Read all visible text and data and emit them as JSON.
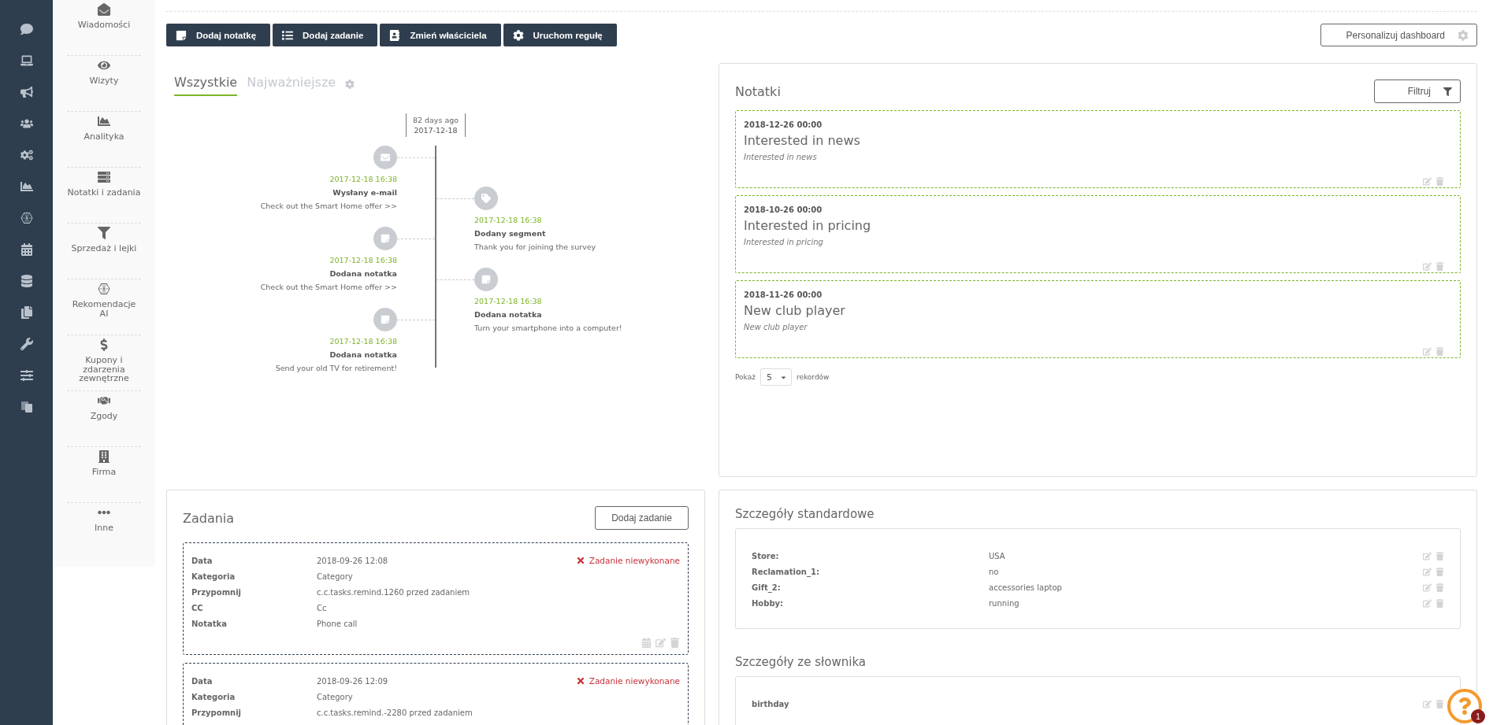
{
  "submenu": [
    {
      "label": "Wiadomości"
    },
    {
      "label": "Wizyty"
    },
    {
      "label": "Analityka"
    },
    {
      "label": "Notatki i zadania"
    },
    {
      "label": "Sprzedaż i lejki"
    },
    {
      "label": "Rekomendacje AI"
    },
    {
      "label": "Kupony i zdarzenia zewnętrzne"
    },
    {
      "label": "Zgody"
    },
    {
      "label": "Firma"
    },
    {
      "label": "Inne"
    }
  ],
  "actions": [
    {
      "label": "Dodaj notatkę"
    },
    {
      "label": "Dodaj zadanie"
    },
    {
      "label": "Zmień właściciela"
    },
    {
      "label": "Uruchom regułę"
    }
  ],
  "personalize_button": "Personalizuj dashboard",
  "timeline": {
    "tabs": [
      {
        "label": "Wszystkie",
        "selected": true
      },
      {
        "label": "Najważniejsze",
        "selected": false
      }
    ],
    "date_marker": {
      "relative": "82 days ago",
      "date": "2017-12-18"
    },
    "events": [
      {
        "kind": "email",
        "time": "2017-12-18 16:38",
        "title": "Wysłany e-mail",
        "text": "Check out the Smart Home offer >>"
      },
      {
        "kind": "segment",
        "time": "2017-12-18 16:38",
        "title": "Dodany segment",
        "text": "Thank you for joining the survey"
      },
      {
        "kind": "note",
        "time": "2017-12-18 16:38",
        "title": "Dodana notatka",
        "text": "Check out the Smart Home offer >>"
      },
      {
        "kind": "note",
        "time": "2017-12-18 16:38",
        "title": "Dodana notatka",
        "text": "Turn your smartphone into a computer!"
      },
      {
        "kind": "note",
        "time": "2017-12-18 16:38",
        "title": "Dodana notatka",
        "text": "Send your old TV for retirement!"
      }
    ]
  },
  "notes": {
    "title": "Notatki",
    "filter_button": "Filtruj",
    "items": [
      {
        "date": "2018-12-26 00:00",
        "title": "Interested in news",
        "text": "Interested in news"
      },
      {
        "date": "2018-10-26 00:00",
        "title": "Interested in pricing",
        "text": "Interested in pricing"
      },
      {
        "date": "2018-11-26 00:00",
        "title": "New club player",
        "text": "New club player"
      }
    ],
    "page_size": {
      "label_before": "Pokaż",
      "value": "5",
      "label_after": "rekordów"
    }
  },
  "tasks": {
    "title": "Zadania",
    "add_button": "Dodaj zadanie",
    "items": [
      {
        "status": "Zadanie niewykonane",
        "fields": [
          {
            "label": "Data",
            "value": "2018-09-26 12:08"
          },
          {
            "label": "Kategoria",
            "value": "Category"
          },
          {
            "label": "Przypomnij",
            "value": "c.c.tasks.remind.1260 przed zadaniem"
          },
          {
            "label": "CC",
            "value": "Cc"
          },
          {
            "label": "Notatka",
            "value": "Phone call"
          }
        ]
      },
      {
        "status": "Zadanie niewykonane",
        "fields": [
          {
            "label": "Data",
            "value": "2018-09-26 12:09"
          },
          {
            "label": "Kategoria",
            "value": "Category"
          },
          {
            "label": "Przypomnij",
            "value": "c.c.tasks.remind.-2280 przed zadaniem"
          }
        ]
      }
    ]
  },
  "standard_details": {
    "title": "Szczegóły standardowe",
    "rows": [
      {
        "label": "Store:",
        "value": "USA"
      },
      {
        "label": "Reclamation_1:",
        "value": "no"
      },
      {
        "label": "Gift_2:",
        "value": "accessories laptop"
      },
      {
        "label": "Hobby:",
        "value": "running"
      }
    ]
  },
  "dictionary_details": {
    "title": "Szczegóły ze słownika",
    "rows": [
      {
        "label": "birthday"
      }
    ]
  },
  "help": {
    "badge": "1"
  }
}
